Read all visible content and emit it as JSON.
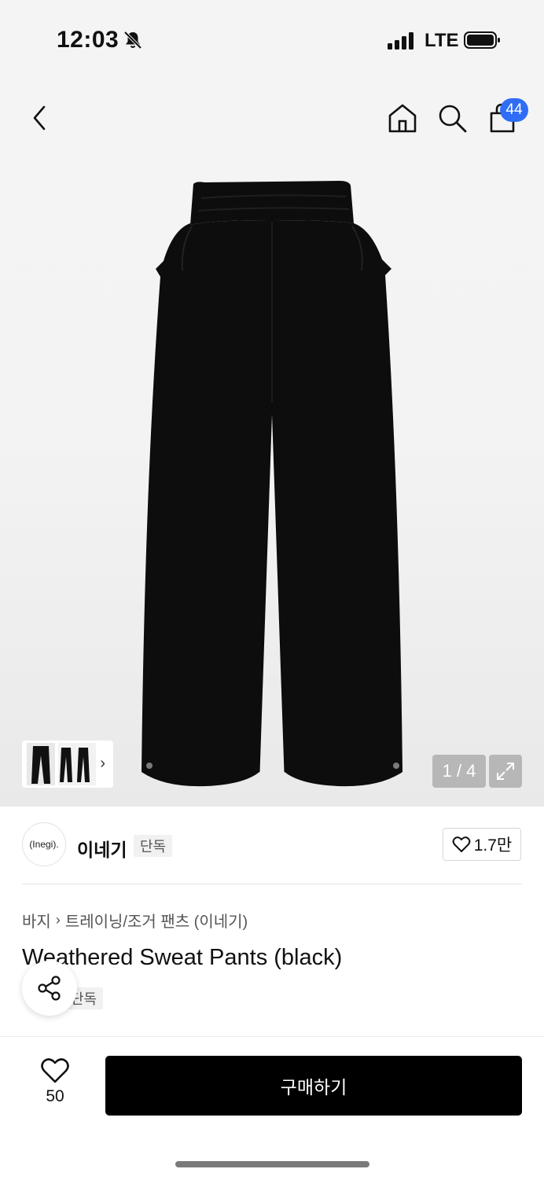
{
  "status_bar": {
    "time": "12:03",
    "network": "LTE"
  },
  "header": {
    "cart_badge": "44"
  },
  "gallery": {
    "page_indicator": "1 / 4"
  },
  "brand": {
    "logo_text": "(Inegi).",
    "name": "이네기",
    "tag": "단독",
    "like_count": "1.7만"
  },
  "breadcrumb": {
    "level1": "바지",
    "level2": "트레이닝/조거 팬츠 (이네기)"
  },
  "product": {
    "title": "Weathered Sweat Pants (black)",
    "tag": "단독"
  },
  "bottom_bar": {
    "wish_count": "50",
    "buy_label": "구매하기"
  },
  "colors": {
    "accent": "#2f6df6",
    "buy_button": "#000000",
    "pants": "#0d0d0d"
  }
}
